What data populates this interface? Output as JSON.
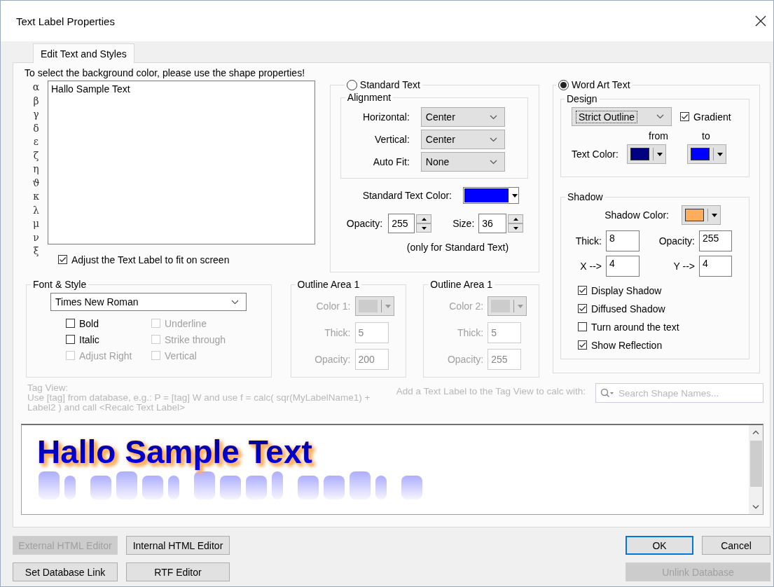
{
  "window": {
    "title": "Text Label Properties"
  },
  "tabs": [
    {
      "label": "Edit Text and Styles",
      "selected": true
    }
  ],
  "hint": "To select the background color, please use the shape properties!",
  "symbols": [
    "α",
    "β",
    "γ",
    "δ",
    "ε",
    "ζ",
    "η",
    "ϑ",
    "κ",
    "λ",
    "μ",
    "ν",
    "ξ"
  ],
  "text_input": {
    "value": "Hallo Sample Text"
  },
  "fit_checkbox": {
    "label": "Adjust the Text Label to fit on screen",
    "checked": true
  },
  "standard_text": {
    "label": "Standard Text",
    "selected": false,
    "alignment": {
      "title": "Alignment",
      "fields": [
        {
          "label": "Horizontal:",
          "value": "Center"
        },
        {
          "label": "Vertical:",
          "value": "Center"
        },
        {
          "label": "Auto Fit:",
          "value": "None"
        }
      ]
    },
    "color_label": "Standard Text Color:",
    "color": "#0000ff",
    "opacity": {
      "label": "Opacity:",
      "value": "255"
    },
    "size": {
      "label": "Size:",
      "value": "36"
    },
    "note": "(only for Standard Text)"
  },
  "word_art": {
    "label": "Word Art Text",
    "selected": true,
    "design": {
      "title": "Design",
      "style": "Strict Outline",
      "gradient": {
        "label": "Gradient",
        "checked": true
      },
      "from_label": "from",
      "to_label": "to",
      "color_label": "Text Color:",
      "text_colors": [
        {
          "color": "#000080"
        },
        {
          "color": "#0000ff"
        }
      ]
    },
    "shadow": {
      "title": "Shadow",
      "color_label": "Shadow Color:",
      "color": "#ffad5b",
      "fields": [
        {
          "label": "Thick:",
          "value": "8"
        },
        {
          "label": "Opacity:",
          "value": "255"
        },
        {
          "label": "X -->",
          "value": "4"
        },
        {
          "label": "Y -->",
          "value": "4"
        }
      ],
      "options": [
        {
          "label": "Display Shadow",
          "checked": true
        },
        {
          "label": "Diffused Shadow",
          "checked": true
        },
        {
          "label": "Turn around the text",
          "checked": false
        },
        {
          "label": "Show Reflection",
          "checked": true
        }
      ]
    }
  },
  "font_style": {
    "title": "Font & Style",
    "font": "Times New Roman",
    "options": [
      {
        "label": "Bold",
        "checked": false,
        "disabled": false
      },
      {
        "label": "Underline",
        "checked": false,
        "disabled": true
      },
      {
        "label": "Italic",
        "checked": false,
        "disabled": false
      },
      {
        "label": "Strike through",
        "checked": false,
        "disabled": true
      },
      {
        "label": "Adjust Right",
        "checked": false,
        "disabled": true
      },
      {
        "label": "Vertical",
        "checked": false,
        "disabled": true
      }
    ]
  },
  "outline_areas": [
    {
      "title": "Outline Area 1",
      "color_label": "Color 1:",
      "thick_label": "Thick:",
      "thick": "5",
      "opacity_label": "Opacity:",
      "opacity": "200",
      "disabled": true
    },
    {
      "title": "Outline Area 1",
      "color_label": "Color 2:",
      "thick_label": "Thick:",
      "thick": "5",
      "opacity_label": "Opacity:",
      "opacity": "255",
      "disabled": true
    }
  ],
  "tag_view": {
    "label": "Tag View:",
    "help": "Use [tag] from database, e.g.: P = [tag] W and use f = calc( sqr(MyLabelName1) + Label2 ) and call <Recalc Text Label>",
    "calc_label": "Add a Text Label to the Tag View to calc with:",
    "search": {
      "placeholder": "Search Shape Names..."
    }
  },
  "preview": {
    "text": "Hallo Sample Text"
  },
  "buttons": [
    {
      "label": "External HTML Editor",
      "disabled": true,
      "default": false
    },
    {
      "label": "Internal HTML Editor",
      "disabled": false,
      "default": false
    },
    {
      "label": "Set Database Link",
      "disabled": false,
      "default": false
    },
    {
      "label": "RTF Editor",
      "disabled": false,
      "default": false
    }
  ],
  "dialog_buttons": [
    {
      "label": "OK",
      "disabled": false,
      "default": true
    },
    {
      "label": "Cancel",
      "disabled": false,
      "default": false
    },
    {
      "label": "Unlink Database",
      "disabled": true,
      "default": false
    }
  ]
}
